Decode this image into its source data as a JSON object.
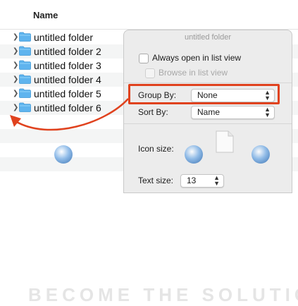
{
  "list": {
    "column_name": "Name",
    "rows": [
      {
        "label": "untitled folder"
      },
      {
        "label": "untitled folder 2"
      },
      {
        "label": "untitled folder 3"
      },
      {
        "label": "untitled folder 4"
      },
      {
        "label": "untitled folder 5"
      },
      {
        "label": "untitled folder 6"
      }
    ]
  },
  "panel": {
    "title": "untitled folder",
    "always_open_label": "Always open in list view",
    "browse_label": "Browse in list view",
    "group_by_label": "Group By:",
    "group_by_value": "None",
    "sort_by_label": "Sort By:",
    "sort_by_value": "Name",
    "icon_size_label": "Icon size:",
    "text_size_label": "Text size:",
    "text_size_value": "13"
  },
  "watermark": "BECOME THE SOLUTION",
  "colors": {
    "accent_red": "#e0421e",
    "folder_blue": "#5fb4ee"
  },
  "icons": [
    "chevron-right-icon",
    "folder-icon",
    "popup-arrows-icon",
    "document-icon"
  ]
}
